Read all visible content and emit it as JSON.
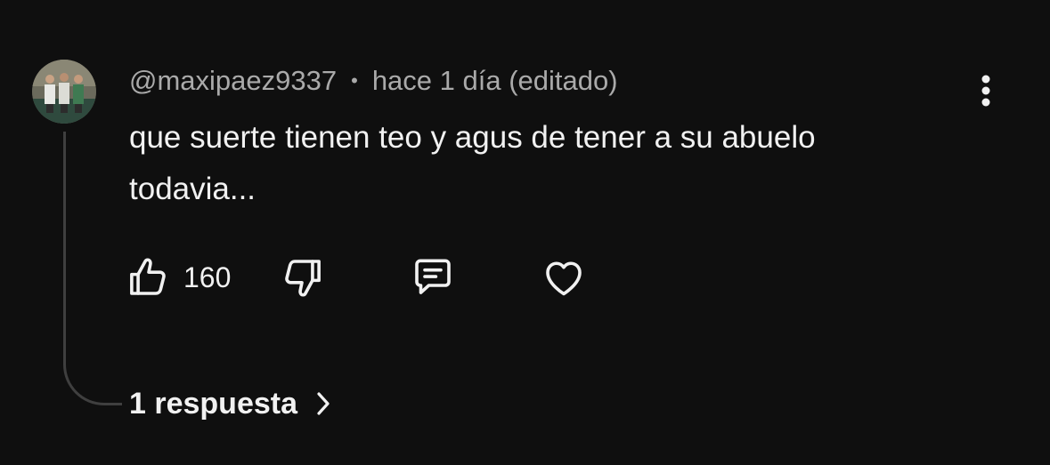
{
  "comment": {
    "author": "@maxipaez9337",
    "separator": "•",
    "timestamp": "hace 1 día (editado)",
    "text": "que suerte tienen teo y agus de tener a su abuelo todavia...",
    "avatar_icon": "profile-photo"
  },
  "actions": {
    "like_count": "160",
    "like_icon": "thumbs-up-icon",
    "dislike_icon": "thumbs-down-icon",
    "reply_icon": "comment-icon",
    "heart_icon": "heart-icon"
  },
  "replies": {
    "label": "1 respuesta",
    "icon": "chevron-right-icon"
  },
  "menu": {
    "icon": "more-vertical-icon"
  },
  "colors": {
    "background": "#0f0f0f",
    "primary_text": "#f1f1f1",
    "secondary_text": "#aaaaaa",
    "thread_line": "#3f3f3f"
  }
}
